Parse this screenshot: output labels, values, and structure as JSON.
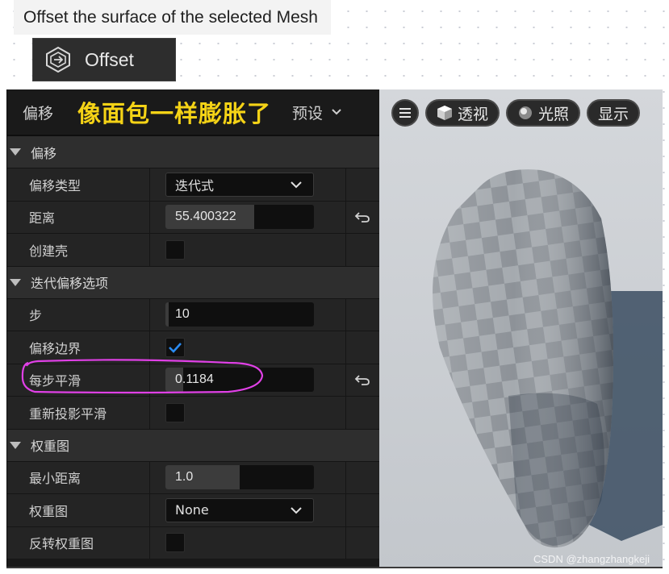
{
  "tooltip": {
    "text": "Offset the surface of the selected Mesh"
  },
  "tool_button": {
    "label": "Offset",
    "icon": "offset-tool-icon"
  },
  "panel": {
    "title": "偏移",
    "annotation": "像面包一样膨胀了",
    "preset_label": "预设",
    "sections": {
      "offset": {
        "label": "偏移",
        "rows": {
          "offset_type": {
            "label": "偏移类型",
            "value": "迭代式"
          },
          "distance": {
            "label": "距离",
            "value": "55.400322",
            "fill_fraction": 0.6
          },
          "create_shell": {
            "label": "创建壳",
            "checked": false
          }
        }
      },
      "iterative": {
        "label": "迭代偏移选项",
        "rows": {
          "steps": {
            "label": "步",
            "value": "10",
            "fill_fraction": 0.02
          },
          "offset_boundaries": {
            "label": "偏移边界",
            "checked": true
          },
          "smooth_per_step": {
            "label": "每步平滑",
            "value": "0.1184",
            "fill_fraction": 0.12
          },
          "reproject_smooth": {
            "label": "重新投影平滑",
            "checked": false
          }
        }
      },
      "weight_map": {
        "label": "权重图",
        "rows": {
          "min_distance": {
            "label": "最小距离",
            "value": "1.0",
            "fill_fraction": 0.5
          },
          "weight_map": {
            "label": "权重图",
            "value": "None"
          },
          "invert_weight_map": {
            "label": "反转权重图",
            "checked": false
          }
        }
      }
    }
  },
  "viewport": {
    "toolbar": {
      "menu_icon": "hamburger-icon",
      "perspective_label": "透视",
      "lighting_label": "光照",
      "show_label": "显示"
    },
    "watermark": "CSDN @zhangzhangkeji"
  },
  "colors": {
    "annotation": "#f5d316",
    "highlight_circle": "#e040e6",
    "checkbox_check": "#2a8bf2",
    "panel_bg": "#1a1a1a"
  }
}
